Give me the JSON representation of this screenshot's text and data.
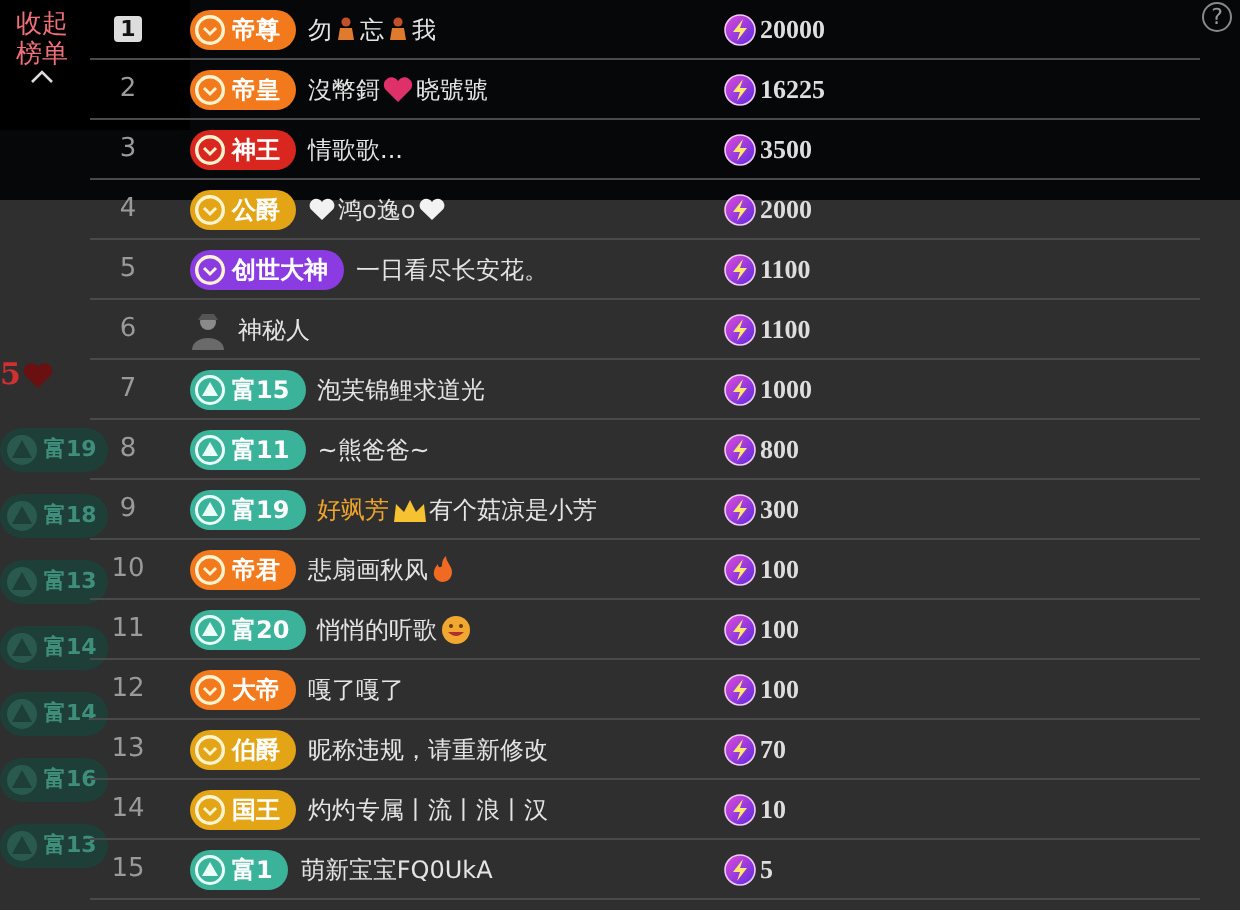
{
  "collapse_button": {
    "label": "收起榜单"
  },
  "help": "?",
  "left_strip": {
    "level_number": "5",
    "badges": [
      {
        "label": "富19"
      },
      {
        "label": "富18"
      },
      {
        "label": "富13"
      },
      {
        "label": "富14"
      },
      {
        "label": "富14"
      },
      {
        "label": "富16"
      },
      {
        "label": "富13"
      }
    ]
  },
  "ranking": [
    {
      "rank": "1",
      "highlighted": true,
      "kind": "badge",
      "badge": {
        "kind": "noble",
        "label": "帝尊",
        "color": "#f27a1c"
      },
      "name": [
        {
          "kind": "text",
          "text": "勿"
        },
        {
          "kind": "figure"
        },
        {
          "kind": "text",
          "text": "忘"
        },
        {
          "kind": "figure"
        },
        {
          "kind": "text",
          "text": "我"
        }
      ],
      "value": "20000"
    },
    {
      "rank": "2",
      "highlighted": false,
      "kind": "badge",
      "badge": {
        "kind": "noble",
        "label": "帝皇",
        "color": "#f27a1c"
      },
      "name": [
        {
          "kind": "text",
          "text": "沒幣鎶"
        },
        {
          "kind": "heart"
        },
        {
          "kind": "text",
          "text": "晓號號"
        }
      ],
      "value": "16225"
    },
    {
      "rank": "3",
      "highlighted": false,
      "kind": "badge",
      "badge": {
        "kind": "noble",
        "label": "神王",
        "color": "#d9261f"
      },
      "name": [
        {
          "kind": "text",
          "text": "情歌歌..."
        }
      ],
      "value": "3500"
    },
    {
      "rank": "4",
      "highlighted": false,
      "kind": "badge",
      "badge": {
        "kind": "noble",
        "label": "公爵",
        "color": "#e3a416"
      },
      "name": [
        {
          "kind": "white-heart"
        },
        {
          "kind": "text",
          "text": "鸿o逸o"
        },
        {
          "kind": "white-heart"
        }
      ],
      "value": "2000"
    },
    {
      "rank": "5",
      "highlighted": false,
      "kind": "badge",
      "badge": {
        "kind": "noble",
        "label": "创世大神",
        "color": "#8b3be2"
      },
      "name": [
        {
          "kind": "text",
          "text": "一日看尽长安花。"
        }
      ],
      "value": "1100"
    },
    {
      "rank": "6",
      "highlighted": false,
      "kind": "mystery",
      "name": [
        {
          "kind": "text",
          "text": "神秘人"
        }
      ],
      "value": "1100"
    },
    {
      "rank": "7",
      "highlighted": false,
      "kind": "badge",
      "badge": {
        "kind": "rich",
        "label": "富15",
        "color": "#3bb39b"
      },
      "name": [
        {
          "kind": "text",
          "text": "泡芙锦鲤求道光"
        }
      ],
      "value": "1000"
    },
    {
      "rank": "8",
      "highlighted": false,
      "kind": "badge",
      "badge": {
        "kind": "rich",
        "label": "富11",
        "color": "#3bb39b"
      },
      "name": [
        {
          "kind": "text",
          "text": "~熊爸爸~"
        }
      ],
      "value": "800"
    },
    {
      "rank": "9",
      "highlighted": false,
      "kind": "badge",
      "badge": {
        "kind": "rich",
        "label": "富19",
        "color": "#3bb39b"
      },
      "name": [
        {
          "kind": "gold-text",
          "text": "好飒芳"
        },
        {
          "kind": "crown"
        },
        {
          "kind": "text",
          "text": "有个菇凉是小芳"
        }
      ],
      "value": "300"
    },
    {
      "rank": "10",
      "highlighted": false,
      "kind": "badge",
      "badge": {
        "kind": "noble",
        "label": "帝君",
        "color": "#f27a1c"
      },
      "name": [
        {
          "kind": "text",
          "text": "悲扇画秋风"
        },
        {
          "kind": "fire"
        }
      ],
      "value": "100"
    },
    {
      "rank": "11",
      "highlighted": false,
      "kind": "badge",
      "badge": {
        "kind": "rich",
        "label": "富20",
        "color": "#3bb39b"
      },
      "name": [
        {
          "kind": "text",
          "text": "悄悄的听歌"
        },
        {
          "kind": "grin"
        }
      ],
      "value": "100"
    },
    {
      "rank": "12",
      "highlighted": false,
      "kind": "badge",
      "badge": {
        "kind": "noble",
        "label": "大帝",
        "color": "#f27a1c"
      },
      "name": [
        {
          "kind": "text",
          "text": "嘎了嘎了"
        }
      ],
      "value": "100"
    },
    {
      "rank": "13",
      "highlighted": false,
      "kind": "badge",
      "badge": {
        "kind": "noble",
        "label": "伯爵",
        "color": "#e3a416"
      },
      "name": [
        {
          "kind": "text",
          "text": "昵称违规，请重新修改"
        }
      ],
      "value": "70"
    },
    {
      "rank": "14",
      "highlighted": false,
      "kind": "badge",
      "badge": {
        "kind": "noble",
        "label": "国王",
        "color": "#e3a416"
      },
      "name": [
        {
          "kind": "text",
          "text": "灼灼专属丨流丨浪丨汉"
        }
      ],
      "value": "10"
    },
    {
      "rank": "15",
      "highlighted": false,
      "kind": "badge",
      "badge": {
        "kind": "rich",
        "label": "富1",
        "color": "#3bb39b"
      },
      "name": [
        {
          "kind": "text",
          "text": "萌新宝宝FQ0UkA"
        }
      ],
      "value": "5"
    }
  ]
}
